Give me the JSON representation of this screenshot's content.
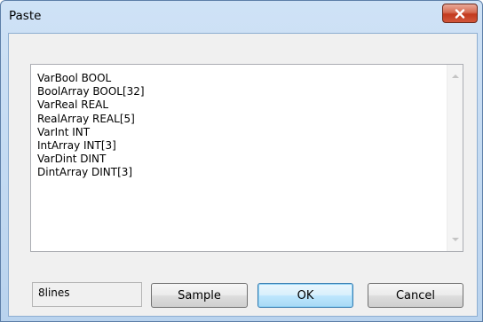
{
  "window": {
    "title": "Paste"
  },
  "paste_text": {
    "lines": [
      "VarBool BOOL",
      "BoolArray BOOL[32]",
      "VarReal REAL",
      "RealArray REAL[5]",
      "VarInt INT",
      "IntArray INT[3]",
      "VarDint DINT",
      "DintArray DINT[3]"
    ]
  },
  "status": {
    "line_count": "8lines"
  },
  "buttons": {
    "sample": "Sample",
    "ok": "OK",
    "cancel": "Cancel"
  },
  "icons": {
    "close": "close-icon",
    "scroll_up": "scroll-up-arrow-icon",
    "scroll_down": "scroll-down-arrow-icon"
  },
  "colors": {
    "close_button": "#c2391d",
    "frame": "#b9d3ee",
    "ok_focus": "#3c7fb1"
  }
}
